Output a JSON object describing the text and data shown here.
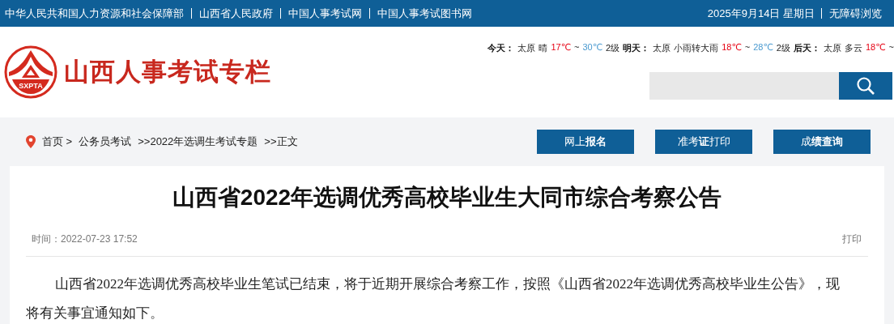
{
  "top_bar": {
    "links": [
      "中华人民共和国人力资源和社会保障部",
      "山西省人民政府",
      "中国人事考试网",
      "中国人事考试图书网"
    ],
    "date": "2025年9月14日 星期日",
    "accessibility": "无障碍浏览"
  },
  "header": {
    "logo": {
      "badge": "SXPTA",
      "title": "山西人事考试专栏"
    },
    "weather": [
      {
        "kind": "label",
        "text": "今天："
      },
      {
        "kind": "plain",
        "text": "太原"
      },
      {
        "kind": "plain",
        "text": "晴"
      },
      {
        "kind": "hot",
        "text": "17℃"
      },
      {
        "kind": "plain",
        "text": "~"
      },
      {
        "kind": "cold",
        "text": "30℃"
      },
      {
        "kind": "plain",
        "text": "2级"
      },
      {
        "kind": "label",
        "text": "明天："
      },
      {
        "kind": "plain",
        "text": "太原"
      },
      {
        "kind": "plain",
        "text": "小雨转大雨"
      },
      {
        "kind": "hot",
        "text": "18℃"
      },
      {
        "kind": "plain",
        "text": "~"
      },
      {
        "kind": "cold",
        "text": "28℃"
      },
      {
        "kind": "plain",
        "text": "2级"
      },
      {
        "kind": "label",
        "text": "后天："
      },
      {
        "kind": "plain",
        "text": "太原"
      },
      {
        "kind": "plain",
        "text": "多云"
      },
      {
        "kind": "hot",
        "text": "18℃"
      },
      {
        "kind": "plain",
        "text": "~"
      }
    ]
  },
  "breadcrumb": [
    "首页 >",
    "公务员考试",
    ">>2022年选调生考试专题",
    ">>正文"
  ],
  "quick_buttons": [
    "网上**报名**",
    "准考**证**打印",
    "成**绩查询**"
  ],
  "article": {
    "title": "山西省2022年选调优秀高校毕业生大同市综合考察公告",
    "time": "时间：2022-07-23 17:52",
    "print": "打印",
    "body": "山西省2022年选调优秀高校毕业生笔试已结束，将于近期开展综合考察工作，按照《山西省2022年选调优秀高校毕业生公告》，现将有关事宜通知如下。"
  }
}
